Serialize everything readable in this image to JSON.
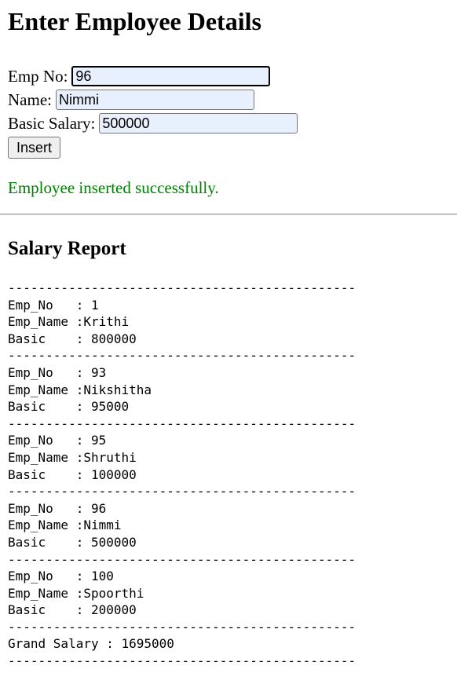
{
  "heading": "Enter Employee Details",
  "form": {
    "empno_label": "Emp No:",
    "empno_value": "96",
    "name_label": "Name:",
    "name_value": "Nimmi",
    "basic_label": "Basic Salary:",
    "basic_value": "500000",
    "insert_label": "Insert"
  },
  "message": "Employee inserted successfully.",
  "report": {
    "title": "Salary Report",
    "separator": "----------------------------------------------",
    "employees": [
      {
        "emp_no": "1",
        "emp_name": "Krithi",
        "basic": "800000"
      },
      {
        "emp_no": "93",
        "emp_name": "Nikshitha",
        "basic": "95000"
      },
      {
        "emp_no": "95",
        "emp_name": "Shruthi",
        "basic": "100000"
      },
      {
        "emp_no": "96",
        "emp_name": "Nimmi",
        "basic": "500000"
      },
      {
        "emp_no": "100",
        "emp_name": "Spoorthi",
        "basic": "200000"
      }
    ],
    "grand_label": "Grand Salary : ",
    "grand_total": "1695000"
  },
  "colors": {
    "success": "#008000",
    "input_bg": "#e8f0fe"
  }
}
